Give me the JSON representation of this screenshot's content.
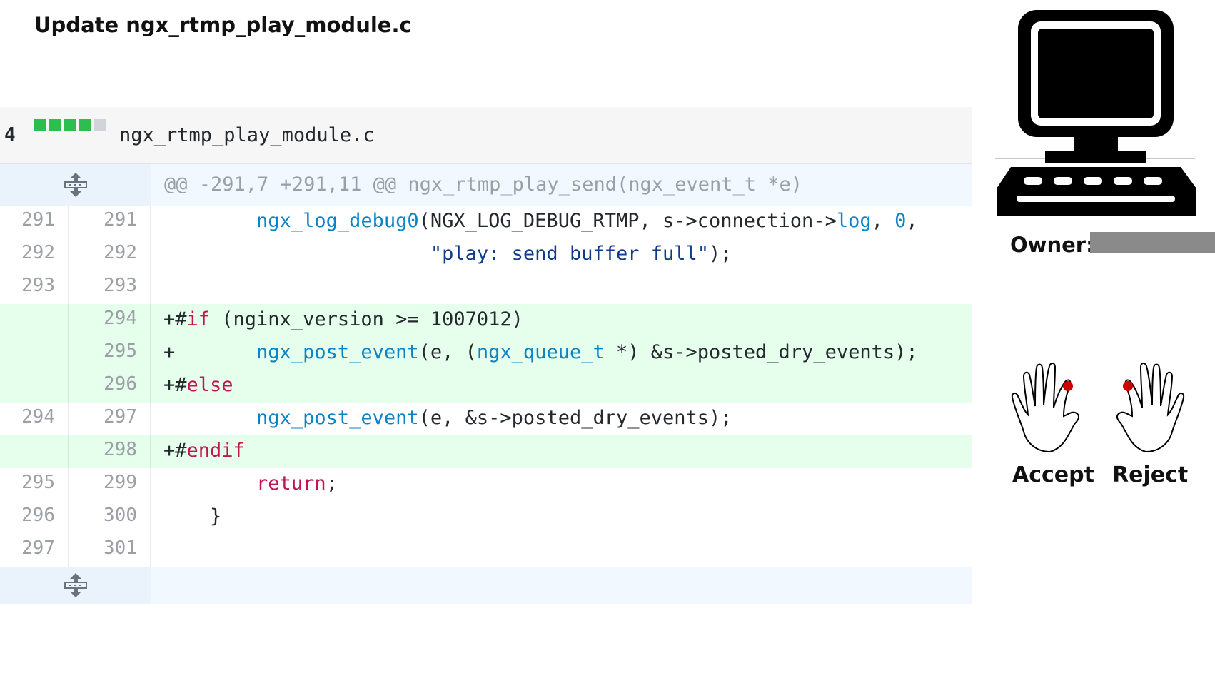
{
  "page": {
    "title": "Update ngx_rtmp_play_module.c"
  },
  "file": {
    "change_count": "4",
    "name": "ngx_rtmp_play_module.c",
    "diffstat": [
      "add",
      "add",
      "add",
      "add",
      "neutral"
    ]
  },
  "hunk_header": "@@ -291,7 +291,11 @@ ngx_rtmp_play_send(ngx_event_t *e)",
  "lines": [
    {
      "old": "291",
      "new": "291",
      "type": "context"
    },
    {
      "old": "292",
      "new": "292",
      "type": "context"
    },
    {
      "old": "293",
      "new": "293",
      "type": "context"
    },
    {
      "old": "",
      "new": "294",
      "type": "add"
    },
    {
      "old": "",
      "new": "295",
      "type": "add"
    },
    {
      "old": "",
      "new": "296",
      "type": "add"
    },
    {
      "old": "294",
      "new": "297",
      "type": "context"
    },
    {
      "old": "",
      "new": "298",
      "type": "add"
    },
    {
      "old": "295",
      "new": "299",
      "type": "context"
    },
    {
      "old": "296",
      "new": "300",
      "type": "context"
    },
    {
      "old": "297",
      "new": "301",
      "type": "context"
    }
  ],
  "code": {
    "l291": {
      "indent": "        ",
      "fn": "ngx_log_debug0",
      "a": "(NGX_LOG_DEBUG_RTMP, s->connection->",
      "fn2": "log",
      "b": ", ",
      "num": "0",
      "c": ","
    },
    "l292": {
      "indent": "                       ",
      "str": "\"play: send buffer full\"",
      "rest": ");"
    },
    "l293": {
      "text": ""
    },
    "l294": {
      "prefix": "+#",
      "kw": "if",
      "rest": " (nginx_version >= 1007012)"
    },
    "l295": {
      "prefix": "+       ",
      "fn": "ngx_post_event",
      "a": "(e, (",
      "type": "ngx_queue_t",
      "b": " *) &s->posted_dry_events);"
    },
    "l296": {
      "prefix": "+#",
      "kw": "else"
    },
    "l297": {
      "indent": "        ",
      "fn": "ngx_post_event",
      "rest": "(e, &s->posted_dry_events);"
    },
    "l298": {
      "prefix": "+#",
      "kw": "endif"
    },
    "l299": {
      "indent": "        ",
      "kw": "return",
      "rest": ";"
    },
    "l300": {
      "indent": "    ",
      "rest": "}"
    },
    "l301": {
      "text": ""
    }
  },
  "owner": {
    "label": "Owner:"
  },
  "choices": {
    "accept": "Accept",
    "reject": "Reject"
  },
  "icons": {
    "computer": "computer-icon",
    "accept_hand": "left-hand-icon",
    "reject_hand": "right-hand-icon",
    "expand": "expand-icon"
  },
  "colors": {
    "added_bg": "#e6ffed",
    "hunk_bg": "#f1f8ff",
    "diffstat_add": "#2cbe4e",
    "marker_red": "#d00000"
  }
}
